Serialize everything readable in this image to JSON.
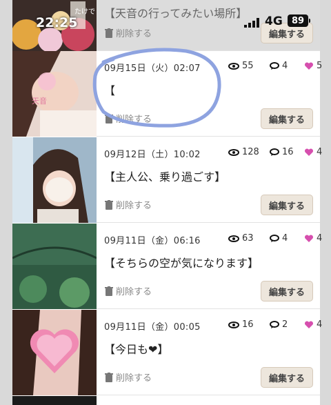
{
  "status_bar": {
    "time": "22:25",
    "network": "4G",
    "battery": "89"
  },
  "actions": {
    "delete_label": "削除する",
    "edit_label": "編集する"
  },
  "icons": {
    "views": "eye-icon",
    "comments": "comment-eye-icon",
    "likes": "heart-icon",
    "delete": "trash-icon"
  },
  "colors": {
    "heart": "#d64fae",
    "edit_bg": "#ede6dc",
    "scribble": "#8ea3e0"
  },
  "thumbnail_overlays": {
    "post0": "たけで",
    "post1": "天音"
  },
  "posts": [
    {
      "date": "",
      "title": "【天音の行ってみたい場所】",
      "views": "",
      "comments": "",
      "likes": ""
    },
    {
      "date": "09月15日（火）02:07",
      "title": "【",
      "views": "55",
      "comments": "4",
      "likes": "5"
    },
    {
      "date": "09月12日（土）10:02",
      "title": "【主人公、乗り過ごす】",
      "views": "128",
      "comments": "16",
      "likes": "4"
    },
    {
      "date": "09月11日（金）06:16",
      "title": "【そちらの空が気になります】",
      "views": "63",
      "comments": "4",
      "likes": "4"
    },
    {
      "date": "09月11日（金）00:05",
      "title": "【今日も❤】",
      "views": "16",
      "comments": "2",
      "likes": "4"
    }
  ]
}
